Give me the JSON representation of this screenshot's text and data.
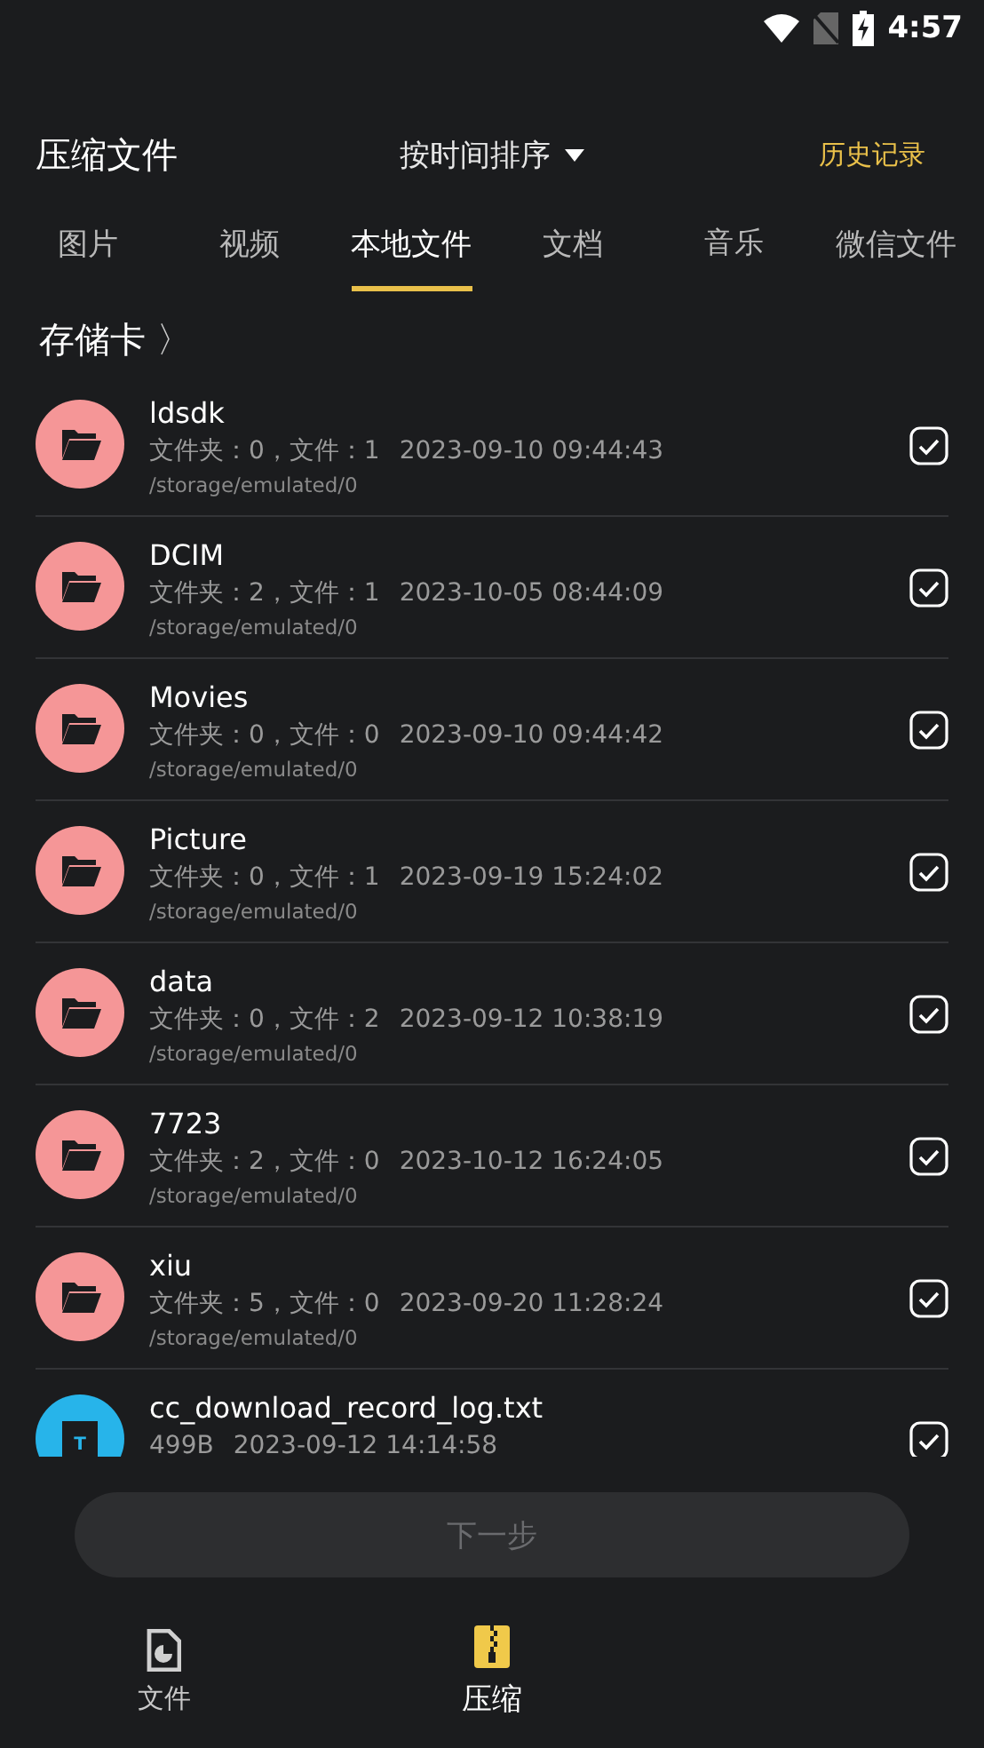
{
  "status_bar": {
    "time": "4:57"
  },
  "header": {
    "title": "压缩文件",
    "sort": "按时间排序",
    "history": "历史记录"
  },
  "tabs": [
    {
      "label": "图片",
      "selected": false
    },
    {
      "label": "视频",
      "selected": false
    },
    {
      "label": "本地文件",
      "selected": true
    },
    {
      "label": "文档",
      "selected": false
    },
    {
      "label": "音乐",
      "selected": false
    },
    {
      "label": "微信文件",
      "selected": false
    }
  ],
  "breadcrumb": {
    "label": "存储卡",
    "chevron": "〉"
  },
  "files": [
    {
      "kind": "folder",
      "name": "ldsdk",
      "info": "文件夹：0，文件：1",
      "date": "2023-09-10 09:44:43",
      "path": "/storage/emulated/0",
      "checked": true
    },
    {
      "kind": "folder",
      "name": "DCIM",
      "info": "文件夹：2，文件：1",
      "date": "2023-10-05 08:44:09",
      "path": "/storage/emulated/0",
      "checked": true
    },
    {
      "kind": "folder",
      "name": "Movies",
      "info": "文件夹：0，文件：0",
      "date": "2023-09-10 09:44:42",
      "path": "/storage/emulated/0",
      "checked": true
    },
    {
      "kind": "folder",
      "name": "Picture",
      "info": "文件夹：0，文件：1",
      "date": "2023-09-19 15:24:02",
      "path": "/storage/emulated/0",
      "checked": true
    },
    {
      "kind": "folder",
      "name": "data",
      "info": "文件夹：0，文件：2",
      "date": "2023-09-12 10:38:19",
      "path": "/storage/emulated/0",
      "checked": true
    },
    {
      "kind": "folder",
      "name": "7723",
      "info": "文件夹：2，文件：0",
      "date": "2023-10-12 16:24:05",
      "path": "/storage/emulated/0",
      "checked": true
    },
    {
      "kind": "folder",
      "name": "xiu",
      "info": "文件夹：5，文件：0",
      "date": "2023-09-20 11:28:24",
      "path": "/storage/emulated/0",
      "checked": true
    },
    {
      "kind": "text",
      "name": "cc_download_record_log.txt",
      "info": "499B",
      "date": "2023-09-12 14:14:58",
      "badge": "T",
      "checked": true
    }
  ],
  "next_button": {
    "label": "下一步",
    "disabled": true
  },
  "bottom_nav": [
    {
      "label": "文件",
      "kind": "file",
      "selected": false
    },
    {
      "label": "压缩",
      "kind": "zip",
      "selected": true
    }
  ]
}
